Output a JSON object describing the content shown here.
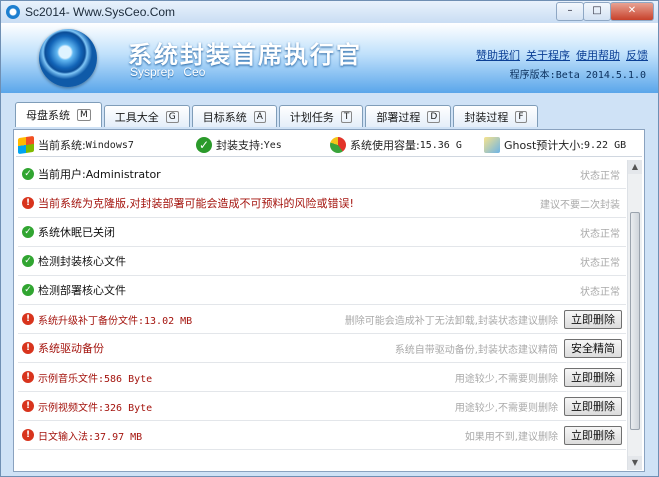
{
  "window": {
    "title": "Sc2014- Www.SysCeo.Com",
    "controls": [
      "–",
      "□",
      "✕"
    ]
  },
  "header": {
    "title": "系统封装首席执行官",
    "subtitle": "Sysprep Ceo",
    "links": [
      "赞助我们",
      "关于程序",
      "使用帮助",
      "反馈"
    ],
    "version": "程序版本:Beta 2014.5.1.0"
  },
  "tabs": [
    {
      "label": "母盘系统",
      "key": "M"
    },
    {
      "label": "工具大全",
      "key": "G"
    },
    {
      "label": "目标系统",
      "key": "A"
    },
    {
      "label": "计划任务",
      "key": "T"
    },
    {
      "label": "部署过程",
      "key": "D"
    },
    {
      "label": "封装过程",
      "key": "F"
    }
  ],
  "stats": {
    "os_label": "当前系统:",
    "os_value": "Windows7",
    "support_label": "封装支持:",
    "support_value": "Yes",
    "usage_label": "系统使用容量:",
    "usage_value": "15.36 G",
    "ghost_label": "Ghost预计大小:",
    "ghost_value": "9.22 GB"
  },
  "rows": [
    {
      "status": "ok",
      "text": "当前用户:Administrator",
      "note": "状态正常",
      "button": ""
    },
    {
      "status": "warn",
      "text": "当前系统为克隆版,对封装部署可能会造成不可预料的风险或错误!",
      "note": "建议不要二次封装",
      "button": ""
    },
    {
      "status": "ok",
      "text": "系统休眠已关闭",
      "note": "状态正常",
      "button": ""
    },
    {
      "status": "ok",
      "text": "检测封装核心文件",
      "note": "状态正常",
      "button": ""
    },
    {
      "status": "ok",
      "text": "检测部署核心文件",
      "note": "状态正常",
      "button": ""
    },
    {
      "status": "warn",
      "text": "系统升级补丁备份文件:13.02 MB",
      "note": "删除可能会造成补丁无法卸载,封装状态建议删除",
      "button": "立即删除"
    },
    {
      "status": "warn",
      "text": "系统驱动备份",
      "note": "系统自带驱动备份,封装状态建议精简",
      "button": "安全精简"
    },
    {
      "status": "warn",
      "text": "示例音乐文件:586 Byte",
      "note": "用途较少,不需要则删除",
      "button": "立即删除"
    },
    {
      "status": "warn",
      "text": "示例视频文件:326 Byte",
      "note": "用途较少,不需要则删除",
      "button": "立即删除"
    },
    {
      "status": "warn",
      "text": "日文输入法:37.97 MB",
      "note": "如果用不到,建议删除",
      "button": "立即删除"
    }
  ],
  "colors": {
    "accent": "#2a7fd3",
    "ok": "#31a531",
    "warn": "#d8341d",
    "warn_text": "#a4140e"
  }
}
